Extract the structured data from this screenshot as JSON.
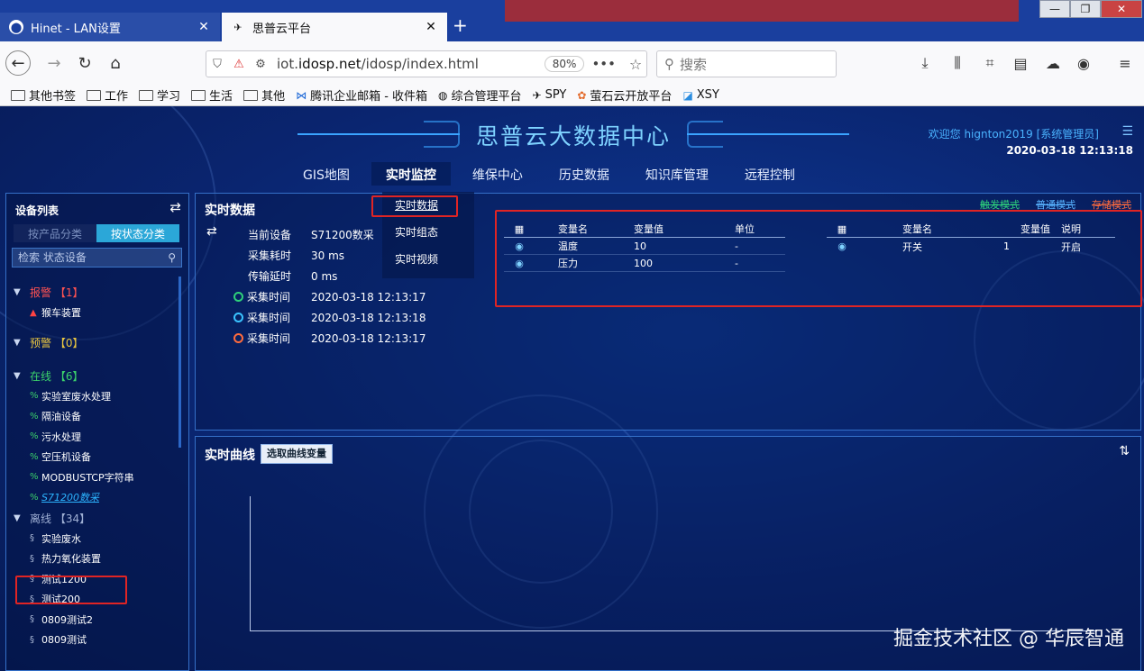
{
  "browser": {
    "tabs": [
      {
        "title": "Hinet - LAN设置",
        "active": false
      },
      {
        "title": "思普云平台",
        "active": true
      }
    ],
    "url_prefix": "iot.",
    "url_host": "idosp.net",
    "url_path": "/idosp/index.html",
    "zoom": "80%",
    "search_placeholder": "搜索",
    "bookmarks": [
      "其他书签",
      "工作",
      "学习",
      "生活",
      "其他",
      "腾讯企业邮箱 - 收件箱",
      "综合管理平台",
      "SPY",
      "萤石云开放平台",
      "XSY"
    ]
  },
  "app": {
    "title": "思普云大数据中心",
    "welcome": "欢迎您  hignton2019 [系统管理员]",
    "datetime": "2020-03-18 12:13:18",
    "nav": [
      "GIS地图",
      "实时监控",
      "维保中心",
      "历史数据",
      "知识库管理",
      "远程控制"
    ],
    "active_nav": "实时监控",
    "submenu": [
      "实时数据",
      "实时组态",
      "实时视频"
    ]
  },
  "sidebar": {
    "heading": "设备列表",
    "seg_product": "按产品分类",
    "seg_status": "按状态分类",
    "search_placeholder": "检索 状态设备",
    "groups": [
      {
        "label": "报警 【1】",
        "items": [
          "猴车装置"
        ]
      },
      {
        "label": "预警 【0】",
        "items": []
      },
      {
        "label": "在线 【6】",
        "items": [
          "实验室废水处理",
          "隔油设备",
          "污水处理",
          "空压机设备",
          "MODBUSTCP字符串",
          "S71200数采"
        ]
      },
      {
        "label": "离线 【34】",
        "items": [
          "实验废水",
          "热力氧化装置",
          "测试1200",
          "测试200",
          "0809测试2",
          "0809测试"
        ]
      }
    ]
  },
  "realtime": {
    "title": "实时数据",
    "modes": [
      "触发模式",
      "普通模式",
      "存储模式"
    ],
    "info": [
      {
        "k": "当前设备",
        "v": "S71200数采"
      },
      {
        "k": "采集耗时",
        "v": "30 ms"
      },
      {
        "k": "传输延时",
        "v": "0 ms"
      }
    ],
    "times": [
      {
        "k": "采集时间",
        "v": "2020-03-18 12:13:17",
        "color": "#2ed07a"
      },
      {
        "k": "采集时间",
        "v": "2020-03-18 12:13:18",
        "color": "#3ac3ff"
      },
      {
        "k": "采集时间",
        "v": "2020-03-18 12:13:17",
        "color": "#ff6b3d"
      }
    ],
    "table1": {
      "headers": [
        "变量名",
        "变量值",
        "单位"
      ],
      "rows": [
        [
          "温度",
          "10",
          "-"
        ],
        [
          "压力",
          "100",
          "-"
        ]
      ]
    },
    "table2": {
      "headers": [
        "变量名",
        "变量值",
        "说明"
      ],
      "rows": [
        [
          "开关",
          "1",
          "开启"
        ]
      ]
    }
  },
  "curve": {
    "title": "实时曲线",
    "button": "选取曲线变量"
  },
  "watermark": "掘金技术社区 @ 华辰智通"
}
